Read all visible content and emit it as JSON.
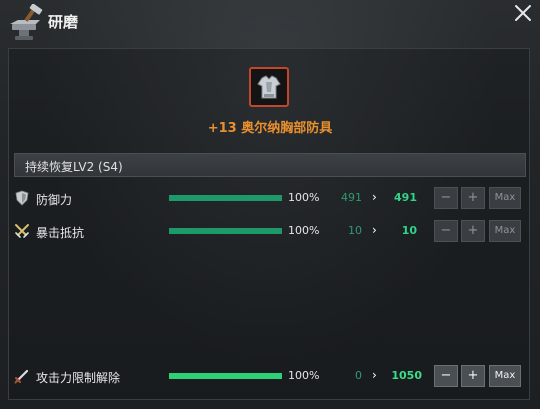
{
  "window": {
    "title": "研磨"
  },
  "item": {
    "name": "+13 奥尔纳胸部防具"
  },
  "section": {
    "label": "持续恢复LV2 (S4)"
  },
  "stats": [
    {
      "label": "防御力",
      "icon": "shield-icon",
      "progress_pct": 100,
      "percent": "100%",
      "from": "491",
      "to": "491"
    },
    {
      "label": "暴击抵抗",
      "icon": "crossed-swords-icon",
      "progress_pct": 100,
      "percent": "100%",
      "from": "10",
      "to": "10"
    }
  ],
  "limit": {
    "label": "攻击力限制解除",
    "icon": "sword-icon",
    "progress_pct": 100,
    "percent": "100%",
    "from": "0",
    "to": "1050"
  },
  "controls": {
    "minus": "−",
    "plus": "+",
    "max": "Max"
  },
  "arrow": "›"
}
